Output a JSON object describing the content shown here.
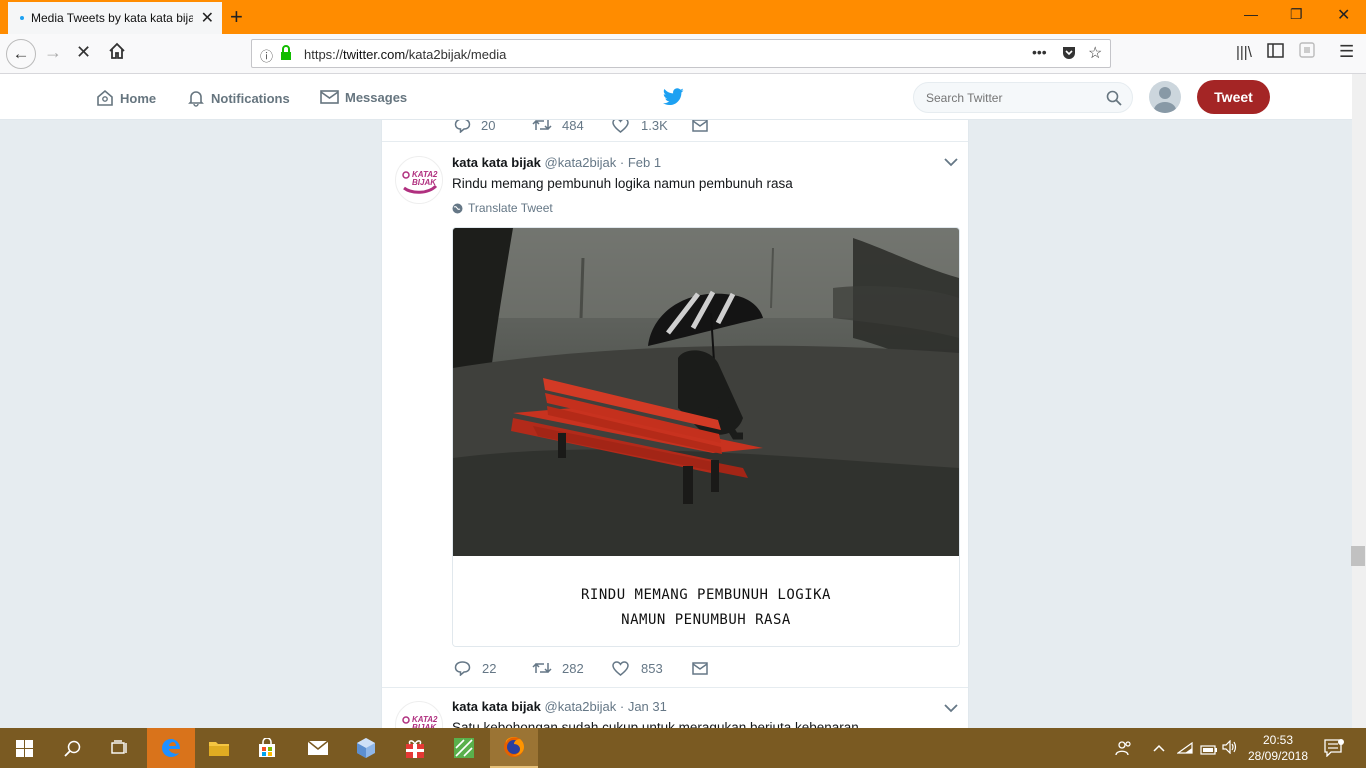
{
  "browser": {
    "tab_title": "Media Tweets by kata kata bijak",
    "url_host": "twitter.com",
    "url_prefix": "https://",
    "url_path": "/kata2bijak/media"
  },
  "twitter_nav": {
    "home": "Home",
    "notifications": "Notifications",
    "messages": "Messages",
    "search_placeholder": "Search Twitter",
    "tweet_button": "Tweet"
  },
  "prev_tweet_actions": {
    "replies": "20",
    "retweets": "484",
    "likes": "1.3K"
  },
  "tweets": [
    {
      "name": "kata kata bijak",
      "handle": "@kata2bijak",
      "date": "· Feb 1",
      "text": "Rindu memang pembunuh logika namun pembunuh rasa",
      "translate": "Translate Tweet",
      "image_caption_line1": "RINDU MEMANG PEMBUNUH LOGIKA",
      "image_caption_line2": "NAMUN PENUMBUH RASA",
      "replies": "22",
      "retweets": "282",
      "likes": "853"
    },
    {
      "name": "kata kata bijak",
      "handle": "@kata2bijak",
      "date": "· Jan 31",
      "text": "Satu kebohongan sudah cukup untuk meragukan berjuta kebenaran"
    }
  ],
  "avatar_logo_text": "KATA2 BIJAK",
  "taskbar": {
    "time": "20:53",
    "date": "28/09/2018"
  },
  "colors": {
    "tab_strip": "#ff8c00",
    "tweet_button": "#a42525",
    "twitter_blue": "#1da1f2",
    "taskbar": "#7a5a22"
  }
}
